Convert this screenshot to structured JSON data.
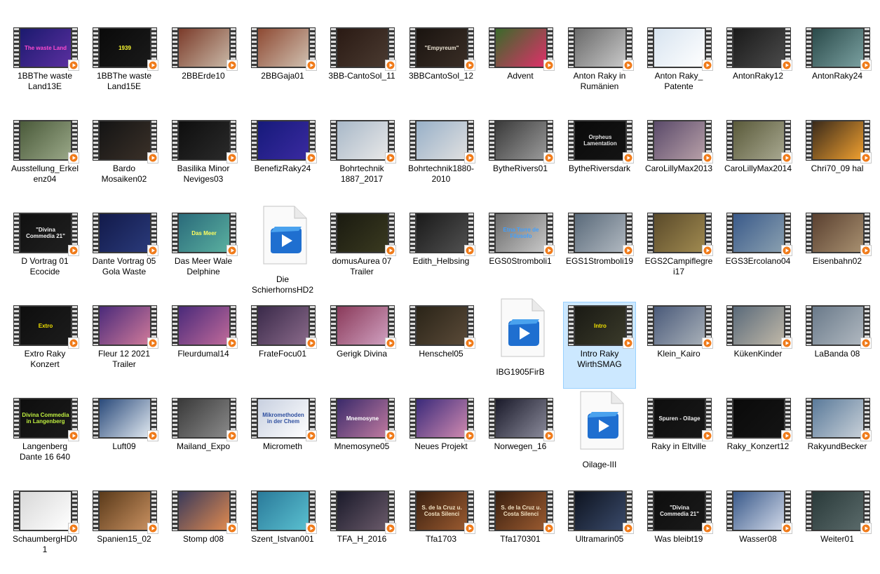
{
  "view": "large-icons",
  "selected_index": 40,
  "files": [
    {
      "name": "1BBThe waste Land13E",
      "type": "video",
      "bg": "#1b1a6e",
      "grad": "#5b2fa0",
      "fg": "#ff4ad0",
      "caption": "The waste Land"
    },
    {
      "name": "1BBThe waste Land15E",
      "type": "video",
      "bg": "#0a0a0a",
      "grad": "#1a1a1a",
      "fg": "#ffff33",
      "caption": "1939"
    },
    {
      "name": "2BBErde10",
      "type": "video",
      "bg": "#7b3b2a",
      "grad": "#c9b8a6",
      "fg": "",
      "caption": ""
    },
    {
      "name": "2BBGaja01",
      "type": "video",
      "bg": "#8e4a33",
      "grad": "#d0c0b0",
      "fg": "",
      "caption": ""
    },
    {
      "name": "3BB-CantoSol_11",
      "type": "video",
      "bg": "#2a1a14",
      "grad": "#4a3a30",
      "fg": "",
      "caption": ""
    },
    {
      "name": "3BBCantoSol_12",
      "type": "video",
      "bg": "#1a1410",
      "grad": "#3a2e26",
      "fg": "#e8e0d0",
      "caption": "\"Empyreum\""
    },
    {
      "name": "Advent",
      "type": "video",
      "bg": "#3a6a2a",
      "grad": "#e0306a",
      "fg": "",
      "caption": ""
    },
    {
      "name": "Anton Raky in Rumänien",
      "type": "video",
      "bg": "#6a6a6a",
      "grad": "#c8c8c8",
      "fg": "",
      "caption": ""
    },
    {
      "name": "Anton Raky_ Patente",
      "type": "video",
      "bg": "#d8e4f0",
      "grad": "#ffffff",
      "fg": "#1a4a8a",
      "caption": ""
    },
    {
      "name": "AntonRaky12",
      "type": "video",
      "bg": "#1a1a1a",
      "grad": "#4a4a4a",
      "fg": "",
      "caption": ""
    },
    {
      "name": "AntonRaky24",
      "type": "video",
      "bg": "#2a4a4a",
      "grad": "#7aa0a0",
      "fg": "",
      "caption": ""
    },
    {
      "name": "Ausstellung_Erkelenz04",
      "type": "video",
      "bg": "#4a5a3a",
      "grad": "#9aa888",
      "fg": "",
      "caption": ""
    },
    {
      "name": "Bardo Mosaiken02",
      "type": "video",
      "bg": "#141414",
      "grad": "#3a3028",
      "fg": "",
      "caption": ""
    },
    {
      "name": "Basilika Minor Neviges03",
      "type": "video",
      "bg": "#0e0e0e",
      "grad": "#2a2a2a",
      "fg": "",
      "caption": ""
    },
    {
      "name": "BenefizRaky24",
      "type": "video",
      "bg": "#161a7a",
      "grad": "#3a2aa0",
      "fg": "#ff4040",
      "caption": ""
    },
    {
      "name": "Bohrtechnik 1887_2017",
      "type": "video",
      "bg": "#a8b8c8",
      "grad": "#e8e8e8",
      "fg": "",
      "caption": ""
    },
    {
      "name": "Bohrtechnik1880-2010",
      "type": "video",
      "bg": "#98b0c8",
      "grad": "#e0e0e0",
      "fg": "",
      "caption": ""
    },
    {
      "name": "BytheRivers01",
      "type": "video",
      "bg": "#3a3a3a",
      "grad": "#9a9a9a",
      "fg": "",
      "caption": ""
    },
    {
      "name": "BytheRiversdark",
      "type": "video",
      "bg": "#0a0a0a",
      "grad": "#141414",
      "fg": "#e0e0e0",
      "caption": "Orpheus Lamentation"
    },
    {
      "name": "CaroLillyMax2013",
      "type": "video",
      "bg": "#5a4a6a",
      "grad": "#b8a0a8",
      "fg": "#ffe000",
      "caption": ""
    },
    {
      "name": "CaroLillyMax2014",
      "type": "video",
      "bg": "#5a5a3a",
      "grad": "#a8a890",
      "fg": "",
      "caption": ""
    },
    {
      "name": "Chri70_09 hal",
      "type": "video",
      "bg": "#3a2a1a",
      "grad": "#f0a030",
      "fg": "",
      "caption": ""
    },
    {
      "name": "D Vortrag 01 Ecocide",
      "type": "video",
      "bg": "#101010",
      "grad": "#202020",
      "fg": "#f0f0f0",
      "caption": "\"Divina Commedia 21\""
    },
    {
      "name": "Dante Vortrag 05 Gola Waste",
      "type": "video",
      "bg": "#121a4a",
      "grad": "#2a3a7a",
      "fg": "#ffffff",
      "caption": ""
    },
    {
      "name": "Das Meer Wale Delphine",
      "type": "video",
      "bg": "#2a6a7a",
      "grad": "#5ab0a0",
      "fg": "#ffff60",
      "caption": "Das Meer"
    },
    {
      "name": "Die SchierhornsHD2",
      "type": "doc"
    },
    {
      "name": "domusAurea 07 Trailer",
      "type": "video",
      "bg": "#1a1a10",
      "grad": "#3a3a20",
      "fg": "",
      "caption": ""
    },
    {
      "name": "Edith_Helbsing",
      "type": "video",
      "bg": "#1a1a1a",
      "grad": "#505050",
      "fg": "",
      "caption": ""
    },
    {
      "name": "EGS0Stromboli1",
      "type": "video",
      "bg": "#6a6a6a",
      "grad": "#c8c8c8",
      "fg": "#40a0ff",
      "caption": "Etna Torre de Filosofo"
    },
    {
      "name": "EGS1Stromboli19",
      "type": "video",
      "bg": "#5a6a7a",
      "grad": "#b0b8c0",
      "fg": "#ff3030",
      "caption": ""
    },
    {
      "name": "EGS2Campiflegrei17",
      "type": "video",
      "bg": "#5a4a2a",
      "grad": "#a08a50",
      "fg": "",
      "caption": ""
    },
    {
      "name": "EGS3Ercolano04",
      "type": "video",
      "bg": "#3a5a8a",
      "grad": "#8aa0b0",
      "fg": "",
      "caption": ""
    },
    {
      "name": "Eisenbahn02",
      "type": "video",
      "bg": "#5a4030",
      "grad": "#a89070",
      "fg": "",
      "caption": ""
    },
    {
      "name": "Extro Raky Konzert",
      "type": "video",
      "bg": "#0e0e0e",
      "grad": "#1c1c1c",
      "fg": "#f0e000",
      "caption": "Extro"
    },
    {
      "name": "Fleur 12 2021 Trailer",
      "type": "video",
      "bg": "#4a2a7a",
      "grad": "#d07a9a",
      "fg": "",
      "caption": ""
    },
    {
      "name": "Fleurdumal14",
      "type": "video",
      "bg": "#4a2a7a",
      "grad": "#c06a9a",
      "fg": "",
      "caption": ""
    },
    {
      "name": "FrateFocu01",
      "type": "video",
      "bg": "#3a2a4a",
      "grad": "#8a6a8a",
      "fg": "",
      "caption": ""
    },
    {
      "name": "Gerigk Divina",
      "type": "video",
      "bg": "#8a3a5a",
      "grad": "#d0a0c0",
      "fg": "",
      "caption": ""
    },
    {
      "name": "Henschel05",
      "type": "video",
      "bg": "#2a2418",
      "grad": "#5a4a38",
      "fg": "",
      "caption": ""
    },
    {
      "name": "IBG1905FirB",
      "type": "doc"
    },
    {
      "name": "Intro Raky WirthSMAG",
      "type": "video",
      "bg": "#1a1a14",
      "grad": "#3a3a2a",
      "fg": "#f0e000",
      "caption": "Intro"
    },
    {
      "name": "Klein_Kairo",
      "type": "video",
      "bg": "#4a5a7a",
      "grad": "#a8b0b8",
      "fg": "",
      "caption": ""
    },
    {
      "name": "KükenKinder",
      "type": "video",
      "bg": "#5a6a7a",
      "grad": "#c0b8a8",
      "fg": "",
      "caption": ""
    },
    {
      "name": "LaBanda 08",
      "type": "video",
      "bg": "#6a7a8a",
      "grad": "#b0b8c0",
      "fg": "",
      "caption": ""
    },
    {
      "name": "Langenberg Dante 16 640",
      "type": "video",
      "bg": "#0e0e0e",
      "grad": "#1a1a1a",
      "fg": "#c0f040",
      "caption": "Divina Commedia in Langenberg"
    },
    {
      "name": "Luft09",
      "type": "video",
      "bg": "#2a4a7a",
      "grad": "#e0e8f0",
      "fg": "",
      "caption": ""
    },
    {
      "name": "Mailand_Expo",
      "type": "video",
      "bg": "#3a3a3a",
      "grad": "#8a8a8a",
      "fg": "",
      "caption": ""
    },
    {
      "name": "Micrometh",
      "type": "video",
      "bg": "#c8d0e0",
      "grad": "#ffffff",
      "fg": "#3050a0",
      "caption": "Mikromethoden in der Chem"
    },
    {
      "name": "Mnemosyne05",
      "type": "video",
      "bg": "#3a2a6a",
      "grad": "#c07aa0",
      "fg": "#ffffff",
      "caption": "Mnemosyne"
    },
    {
      "name": "Neues Projekt",
      "type": "video",
      "bg": "#3a2a7a",
      "grad": "#d08ab0",
      "fg": "",
      "caption": ""
    },
    {
      "name": "Norwegen_16",
      "type": "video",
      "bg": "#1a1a2a",
      "grad": "#8a8a9a",
      "fg": "",
      "caption": ""
    },
    {
      "name": "Oilage-III",
      "type": "doc"
    },
    {
      "name": "Raky in Eltville",
      "type": "video",
      "bg": "#0e0e0e",
      "grad": "#181818",
      "fg": "#f0f0f0",
      "caption": "Spuren - Oilage"
    },
    {
      "name": "Raky_Konzert12",
      "type": "video",
      "bg": "#0a0a0a",
      "grad": "#141414",
      "fg": "",
      "caption": ""
    },
    {
      "name": "RakyundBecker",
      "type": "video",
      "bg": "#5a7a9a",
      "grad": "#c8d0d8",
      "fg": "",
      "caption": ""
    },
    {
      "name": "SchaumbergHD01",
      "type": "video",
      "bg": "#d8d8d8",
      "grad": "#ffffff",
      "fg": "",
      "caption": ""
    },
    {
      "name": "Spanien15_02",
      "type": "video",
      "bg": "#5a3a1a",
      "grad": "#c89060",
      "fg": "",
      "caption": ""
    },
    {
      "name": "Stomp d08",
      "type": "video",
      "bg": "#3a3a5a",
      "grad": "#e08a50",
      "fg": "",
      "caption": ""
    },
    {
      "name": "Szent_Istvan001",
      "type": "video",
      "bg": "#2a7a9a",
      "grad": "#5ac0d0",
      "fg": "",
      "caption": ""
    },
    {
      "name": "TFA_H_2016",
      "type": "video",
      "bg": "#1a1a2a",
      "grad": "#6a5a6a",
      "fg": "",
      "caption": ""
    },
    {
      "name": "Tfa1703",
      "type": "video",
      "bg": "#3a2010",
      "grad": "#9a5a30",
      "fg": "#f0e0c0",
      "caption": "S. de la Cruz u. Costa Silenci"
    },
    {
      "name": "Tfa170301",
      "type": "video",
      "bg": "#3a2010",
      "grad": "#9a5a30",
      "fg": "#f0e0c0",
      "caption": "S. de la Cruz u. Costa Silenci"
    },
    {
      "name": "Ultramarin05",
      "type": "video",
      "bg": "#0e1420",
      "grad": "#3a4a6a",
      "fg": "",
      "caption": ""
    },
    {
      "name": "Was bleibt19",
      "type": "video",
      "bg": "#0e0e0e",
      "grad": "#1a1a1a",
      "fg": "#f0f0f0",
      "caption": "\"Divina Commedia 21\""
    },
    {
      "name": "Wasser08",
      "type": "video",
      "bg": "#3a5a8a",
      "grad": "#d0d8e8",
      "fg": "",
      "caption": ""
    },
    {
      "name": "Weiter01",
      "type": "video",
      "bg": "#2a3a3a",
      "grad": "#5a6a6a",
      "fg": "",
      "caption": ""
    }
  ]
}
